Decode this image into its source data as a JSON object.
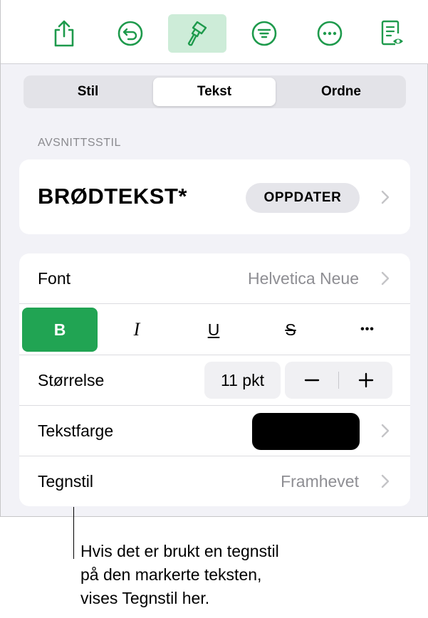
{
  "toolbar": {
    "buttons": [
      {
        "name": "share-icon",
        "active": false
      },
      {
        "name": "undo-icon",
        "active": false
      },
      {
        "name": "paintbrush-icon",
        "active": true
      },
      {
        "name": "filter-icon",
        "active": false
      },
      {
        "name": "more-icon",
        "active": false
      },
      {
        "name": "document-view-icon",
        "active": false
      }
    ]
  },
  "tabs": {
    "items": [
      "Stil",
      "Tekst",
      "Ordne"
    ],
    "selected": "Tekst"
  },
  "paragraph_style": {
    "header": "AVSNITTSSTIL",
    "name": "BRØDTEKST*",
    "update_label": "OPPDATER"
  },
  "font_row": {
    "label": "Font",
    "value": "Helvetica Neue"
  },
  "format_buttons": {
    "bold": "B",
    "italic": "I",
    "underline": "U",
    "strikethrough": "S",
    "more": "•••"
  },
  "size_row": {
    "label": "Størrelse",
    "value": "11 pkt"
  },
  "color_row": {
    "label": "Tekstfarge",
    "color": "#000000"
  },
  "char_style_row": {
    "label": "Tegnstil",
    "value": "Framhevet"
  },
  "callout": {
    "lines": [
      "Hvis det er brukt en tegnstil",
      "på den markerte teksten,",
      "vises Tegnstil her."
    ]
  },
  "colors": {
    "accent": "#21a453",
    "icon_green": "#1e9a4c",
    "active_bg": "#cdecd8"
  }
}
